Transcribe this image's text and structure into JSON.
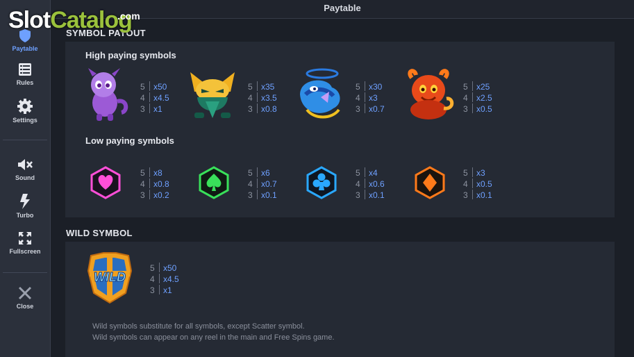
{
  "header": {
    "title": "Paytable"
  },
  "logo": {
    "part1": "Slot",
    "part2": "Catalog",
    "suffix": ".com"
  },
  "sidebar": {
    "items": [
      {
        "label": "Paytable",
        "icon": "paytable-icon",
        "active": true
      },
      {
        "label": "Rules",
        "icon": "rules-icon"
      },
      {
        "label": "Settings",
        "icon": "gear-icon"
      },
      {
        "label": "Sound",
        "icon": "sound-muted-icon"
      },
      {
        "label": "Turbo",
        "icon": "turbo-icon"
      },
      {
        "label": "Fullscreen",
        "icon": "fullscreen-icon"
      },
      {
        "label": "Close",
        "icon": "close-icon"
      }
    ]
  },
  "symbol_payout": {
    "title": "SYMBOL PAYOUT",
    "high_title": "High paying symbols",
    "low_title": "Low paying symbols",
    "high": [
      {
        "icon": "purple-dragon-icon",
        "rows": [
          [
            "5",
            "x50"
          ],
          [
            "4",
            "x4.5"
          ],
          [
            "3",
            "x1"
          ]
        ]
      },
      {
        "icon": "yellow-cat-creature-icon",
        "rows": [
          [
            "5",
            "x35"
          ],
          [
            "4",
            "x3.5"
          ],
          [
            "3",
            "x0.8"
          ]
        ]
      },
      {
        "icon": "blue-serpent-icon",
        "rows": [
          [
            "5",
            "x30"
          ],
          [
            "4",
            "x3"
          ],
          [
            "3",
            "x0.7"
          ]
        ]
      },
      {
        "icon": "fire-creature-icon",
        "rows": [
          [
            "5",
            "x25"
          ],
          [
            "4",
            "x2.5"
          ],
          [
            "3",
            "x0.5"
          ]
        ]
      }
    ],
    "low": [
      {
        "icon": "heart-hexagon-icon",
        "color": "#ff4fd8",
        "rows": [
          [
            "5",
            "x8"
          ],
          [
            "4",
            "x0.8"
          ],
          [
            "3",
            "x0.2"
          ]
        ]
      },
      {
        "icon": "spade-hexagon-icon",
        "color": "#39e05a",
        "rows": [
          [
            "5",
            "x6"
          ],
          [
            "4",
            "x0.7"
          ],
          [
            "3",
            "x0.1"
          ]
        ]
      },
      {
        "icon": "club-hexagon-icon",
        "color": "#2aa8ff",
        "rows": [
          [
            "5",
            "x4"
          ],
          [
            "4",
            "x0.6"
          ],
          [
            "3",
            "x0.1"
          ]
        ]
      },
      {
        "icon": "diamond-hexagon-icon",
        "color": "#ff7a1a",
        "rows": [
          [
            "5",
            "x3"
          ],
          [
            "4",
            "x0.5"
          ],
          [
            "3",
            "x0.1"
          ]
        ]
      }
    ]
  },
  "wild": {
    "title": "WILD SYMBOL",
    "icon": "wild-shield-icon",
    "icon_text": "WILD",
    "rows": [
      [
        "5",
        "x50"
      ],
      [
        "4",
        "x4.5"
      ],
      [
        "3",
        "x1"
      ]
    ],
    "desc1": "Wild symbols substitute for all symbols, except Scatter symbol.",
    "desc2": "Wild symbols can appear on any reel in the main and Free Spins game."
  }
}
